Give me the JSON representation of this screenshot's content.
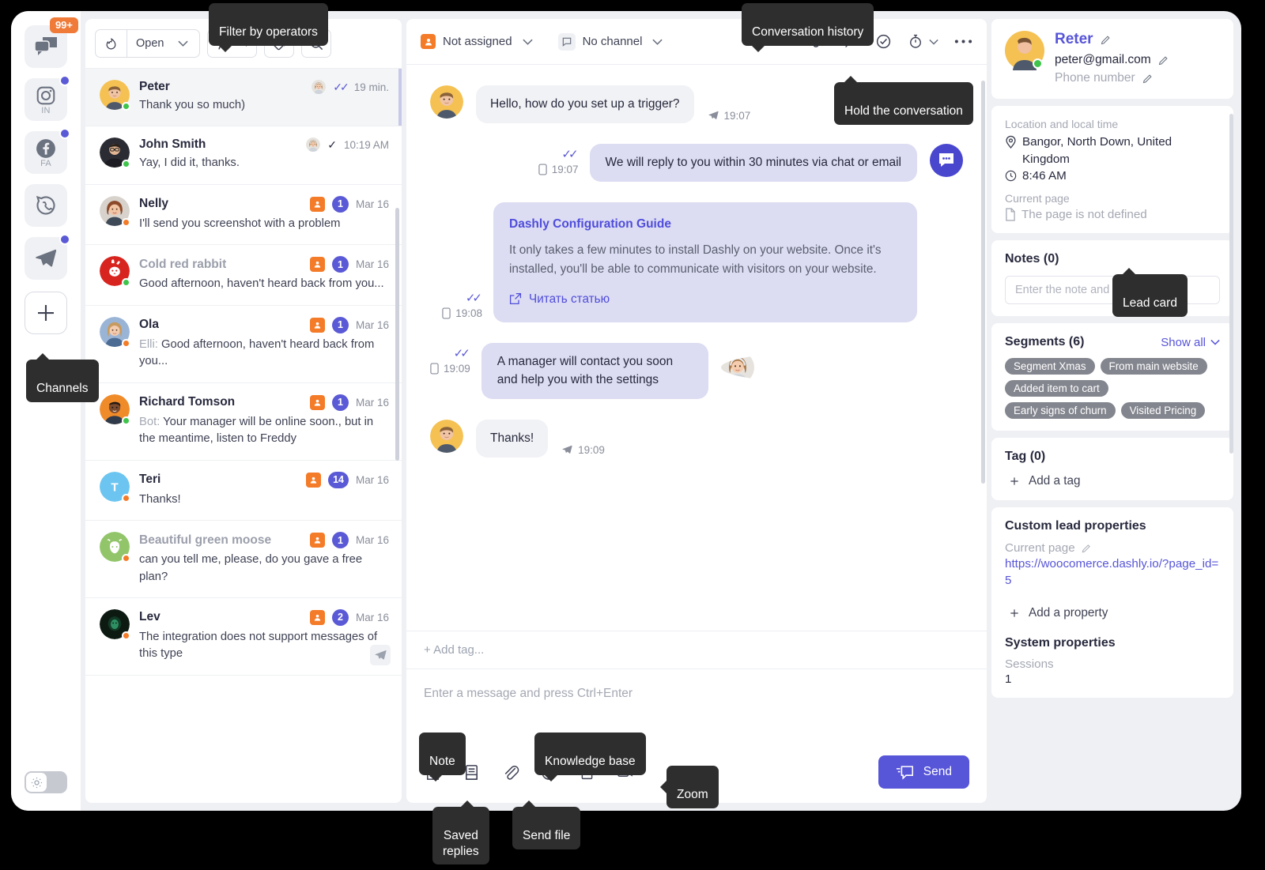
{
  "rail": {
    "items": [
      {
        "name": "chats",
        "icon": "chats-icon",
        "badge": "99+",
        "sublabel": "",
        "dot": false,
        "active": true
      },
      {
        "name": "instagram",
        "icon": "instagram-icon",
        "badge": "",
        "sublabel": "IN",
        "dot": true,
        "active": false
      },
      {
        "name": "facebook",
        "icon": "facebook-icon",
        "badge": "",
        "sublabel": "FA",
        "dot": true,
        "active": false
      },
      {
        "name": "whatsapp",
        "icon": "whatsapp-icon",
        "badge": "",
        "sublabel": "",
        "dot": false,
        "active": false
      },
      {
        "name": "telegram",
        "icon": "telegram-icon",
        "badge": "",
        "sublabel": "",
        "dot": true,
        "active": false
      }
    ],
    "add_label": "+",
    "theme_toggle_icon": "sun-icon"
  },
  "filters": {
    "fire_icon": "fire-icon",
    "status": "Open",
    "operators_icon": "operators-icon",
    "tag_icon": "tag-icon",
    "search_icon": "search-icon"
  },
  "conversations": [
    {
      "name": "Peter",
      "name_muted": false,
      "preview": "Thank you so much)",
      "prefix": "",
      "time": "19 min.",
      "check": "double",
      "operator_avatar": true,
      "assigned": false,
      "count": "",
      "presence": "online",
      "avatar_bg": "#f5c152",
      "avatar_type": "photo-man-blond",
      "initial": "",
      "selected": true
    },
    {
      "name": "John Smith",
      "name_muted": false,
      "preview": "Yay, I did it, thanks.",
      "prefix": "",
      "time": "10:19 AM",
      "check": "single",
      "operator_avatar": true,
      "assigned": false,
      "count": "",
      "presence": "online",
      "avatar_bg": "#2b2b33",
      "avatar_type": "photo-man-glasses",
      "initial": "",
      "selected": false
    },
    {
      "name": "Nelly",
      "name_muted": false,
      "preview": "I'll send you screenshot with a problem",
      "prefix": "",
      "time": "Mar 16",
      "check": "",
      "operator_avatar": false,
      "assigned": true,
      "count": "1",
      "presence": "away",
      "avatar_bg": "#b5705a",
      "avatar_type": "photo-woman-red",
      "initial": "",
      "selected": false
    },
    {
      "name": "Cold red rabbit",
      "name_muted": true,
      "preview": "Good afternoon, haven't heard back from you...",
      "prefix": "",
      "time": "Mar 16",
      "check": "",
      "operator_avatar": false,
      "assigned": true,
      "count": "1",
      "presence": "online",
      "avatar_bg": "#d8241f",
      "avatar_type": "animal-rabbit",
      "initial": "",
      "selected": false
    },
    {
      "name": "Ola",
      "name_muted": false,
      "preview": "Good afternoon, haven't heard back from you...",
      "prefix": "Elli:",
      "time": "Mar 16",
      "check": "",
      "operator_avatar": false,
      "assigned": true,
      "count": "1",
      "presence": "away",
      "avatar_bg": "#9ab4d6",
      "avatar_type": "photo-woman-blonde",
      "initial": "",
      "selected": false
    },
    {
      "name": "Richard Tomson",
      "name_muted": false,
      "preview": "Your manager will be online soon., but in the meantime, listen to Freddy",
      "prefix": "Bot:",
      "time": "Mar 16",
      "check": "",
      "operator_avatar": false,
      "assigned": true,
      "count": "1",
      "presence": "online",
      "avatar_bg": "#f08b2a",
      "avatar_type": "photo-man-dark",
      "initial": "",
      "selected": false
    },
    {
      "name": "Teri",
      "name_muted": false,
      "preview": "Thanks!",
      "prefix": "",
      "time": "Mar 16",
      "check": "",
      "operator_avatar": false,
      "assigned": true,
      "count": "14",
      "presence": "away",
      "avatar_bg": "#6cc5f0",
      "avatar_type": "initial",
      "initial": "T",
      "selected": false
    },
    {
      "name": "Beautiful green moose",
      "name_muted": true,
      "preview": "can you tell me, please, do you gave a free plan?",
      "prefix": "",
      "time": "Mar 16",
      "check": "",
      "operator_avatar": false,
      "assigned": true,
      "count": "1",
      "presence": "away",
      "avatar_bg": "#92c56a",
      "avatar_type": "animal-moose",
      "initial": "",
      "selected": false
    },
    {
      "name": "Lev",
      "name_muted": false,
      "preview": "The integration does not support messages of this type",
      "prefix": "",
      "time": "Mar 16",
      "check": "",
      "operator_avatar": false,
      "assigned": true,
      "count": "2",
      "presence": "away",
      "avatar_bg": "#0d1a12",
      "avatar_type": "photo-dark-green",
      "initial": "",
      "selected": false
    }
  ],
  "chat_header": {
    "assignee": "Not assigned",
    "assignee_icon": "person-icon",
    "channel": "No channel",
    "channel_icon": "chat-icon",
    "actions": [
      "link-icon",
      "comment-icon",
      "check-circle-icon",
      "timer-icon",
      "more-icon"
    ]
  },
  "messages": [
    {
      "kind": "in",
      "text": "Hello, how do you set up a trigger?",
      "time": "19:07",
      "stamp_icon": "paperplane-icon",
      "ticks": "",
      "avatar": "photo-man-blond"
    },
    {
      "kind": "out",
      "text": "We will reply to you within 30 minutes via chat or email",
      "time": "19:07",
      "stamp_icon": "phone-icon",
      "ticks": "double",
      "avatar": "bot"
    },
    {
      "kind": "out-card",
      "card_title": "Dashly Configuration Guide",
      "text": "It only takes a few minutes to install Dashly on your website. Once it's installed, you'll be able to communicate with visitors on your website.",
      "link_text": "Читать статью",
      "link_icon": "external-link-icon",
      "time": "19:08",
      "stamp_icon": "phone-icon",
      "ticks": "double",
      "avatar": ""
    },
    {
      "kind": "out",
      "text": "A manager will contact you soon and help you with the settings",
      "time": "19:09",
      "stamp_icon": "phone-icon",
      "ticks": "double",
      "avatar": "photo-woman-operator"
    },
    {
      "kind": "in",
      "text": "Thanks!",
      "time": "19:09",
      "stamp_icon": "paperplane-icon",
      "ticks": "",
      "avatar": "photo-man-blond"
    }
  ],
  "composer": {
    "add_tag": "+ Add tag...",
    "placeholder": "Enter a message and press Ctrl+Enter",
    "tools": [
      "note-icon",
      "saved-replies-icon",
      "attachment-icon",
      "emoji-icon",
      "knowledge-base-icon",
      "video-icon"
    ],
    "send_label": "Send",
    "send_icon": "send-chat-icon",
    "send_color": "#5755d8"
  },
  "lead": {
    "name": "Reter",
    "email": "peter@gmail.com",
    "phone_placeholder": "Phone number",
    "location_label": "Location and local time",
    "location": "Bangor, North Down, United Kingdom",
    "local_time": "8:46 AM",
    "current_page_label": "Current page",
    "current_page_value": "The page is not defined",
    "notes_title": "Notes (0)",
    "note_placeholder": "Enter the note and press Enter",
    "segments_title": "Segments (6)",
    "show_all": "Show all",
    "segments": [
      "Segment Xmas",
      "From main website",
      "Added item to cart",
      "Early signs of churn",
      "Visited Pricing"
    ],
    "tag_title": "Tag (0)",
    "add_tag": "Add a tag",
    "custom_props_title": "Custom lead properties",
    "custom_prop_label": "Current page",
    "custom_prop_value": "https://woocomerce.dashly.io/?page_id=5",
    "add_property": "Add a property",
    "system_props_title": "System properties",
    "sessions_label": "Sessions",
    "sessions_value": "1"
  },
  "tooltips": {
    "filter_by_operators": "Filter by operators",
    "conversation_history": "Conversation history",
    "hold_the_conversation": "Hold the conversation",
    "channels": "Channels",
    "lead_card": "Lead card",
    "note": "Note",
    "saved_replies": "Saved\nreplies",
    "send_file": "Send file",
    "knowledge_base": "Knowledge base",
    "zoom": "Zoom"
  }
}
